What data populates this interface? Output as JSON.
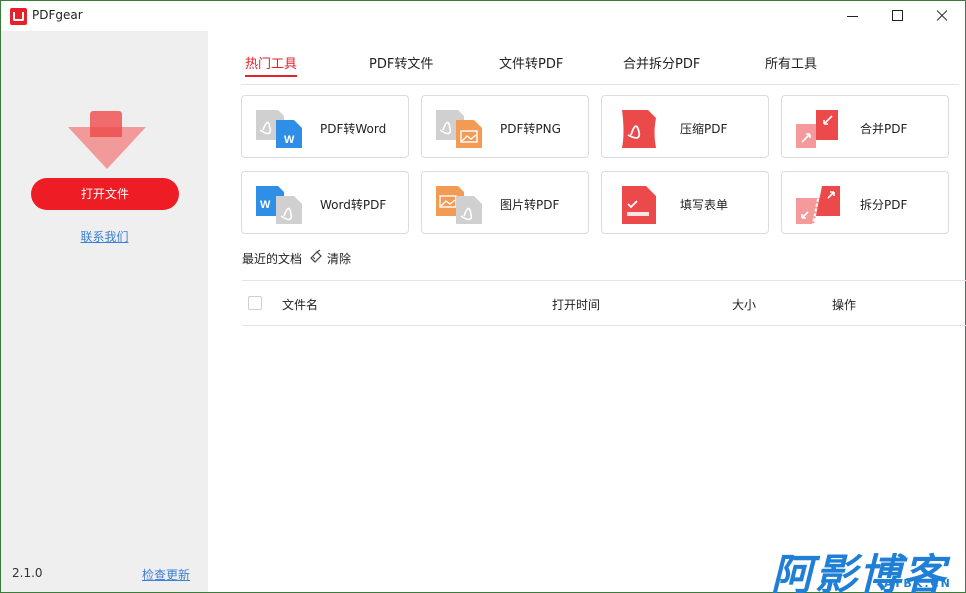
{
  "window": {
    "title": "PDFgear"
  },
  "sidebar": {
    "open_button": "打开文件",
    "contact_link": "联系我们",
    "version": "2.1.0",
    "update_link": "检查更新"
  },
  "tabs": [
    {
      "label": "热门工具",
      "active": true
    },
    {
      "label": "PDF转文件",
      "active": false
    },
    {
      "label": "文件转PDF",
      "active": false
    },
    {
      "label": "合并拆分PDF",
      "active": false
    },
    {
      "label": "所有工具",
      "active": false
    }
  ],
  "tools": [
    {
      "label": "PDF转Word",
      "icon": "pdf-to-word-icon"
    },
    {
      "label": "PDF转PNG",
      "icon": "pdf-to-png-icon"
    },
    {
      "label": "压缩PDF",
      "icon": "compress-pdf-icon"
    },
    {
      "label": "合并PDF",
      "icon": "merge-pdf-icon"
    },
    {
      "label": "Word转PDF",
      "icon": "word-to-pdf-icon"
    },
    {
      "label": "图片转PDF",
      "icon": "image-to-pdf-icon"
    },
    {
      "label": "填写表单",
      "icon": "fill-form-icon"
    },
    {
      "label": "拆分PDF",
      "icon": "split-pdf-icon"
    }
  ],
  "recent": {
    "title": "最近的文档",
    "clear_label": "清除",
    "columns": [
      "文件名",
      "打开时间",
      "大小",
      "操作"
    ],
    "rows": []
  },
  "watermark": {
    "text": "阿影博客",
    "sub": "AYBK.CN"
  },
  "colors": {
    "accent": "#e8202a",
    "link": "#3b7fd4",
    "sidebar_bg": "#efefef"
  }
}
